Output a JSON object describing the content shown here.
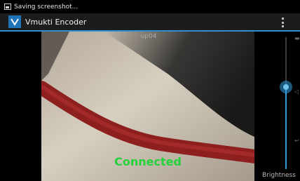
{
  "status_bar": {
    "notification": "Saving screenshot..."
  },
  "app": {
    "title": "Vmukti Encoder",
    "logo_letter": "V"
  },
  "stream": {
    "name": "up04",
    "status": "Connected",
    "status_color": "#23d23a"
  },
  "brightness": {
    "label": "Brightness",
    "level_fraction": 0.62
  },
  "colors": {
    "accent": "#2f8fcf",
    "slider_accent": "#2f9fe0"
  },
  "icons": {
    "status_bar": "screenshot-icon",
    "action_bar_logo": "vmukti-logo-icon",
    "menu": "overflow-menu-icon",
    "edge": [
      "edge-icon-top",
      "edge-icon-middle",
      "edge-icon-bottom"
    ]
  }
}
